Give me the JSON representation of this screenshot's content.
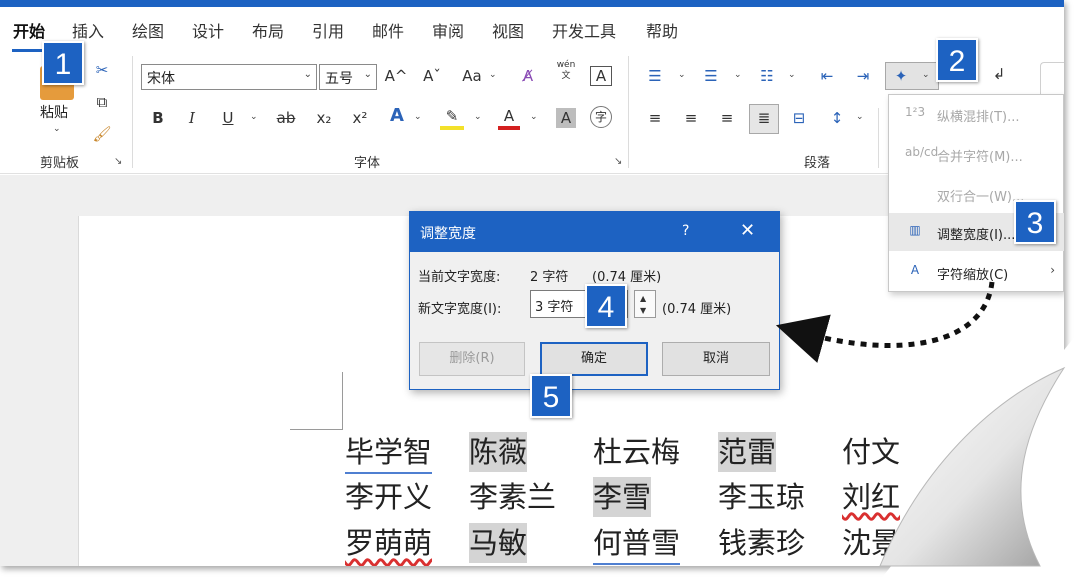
{
  "colors": {
    "accent": "#1d62c2",
    "callout": "#1d62c2",
    "highlight": "#d4d4d4",
    "menu_hover": "#e8e8e8"
  },
  "tabs": [
    "开始",
    "插入",
    "绘图",
    "设计",
    "布局",
    "引用",
    "邮件",
    "审阅",
    "视图",
    "开发工具",
    "帮助"
  ],
  "clipboard": {
    "paste_label": "粘贴",
    "group_label": "剪贴板",
    "icons": [
      "paste-icon",
      "cut-icon",
      "copy-icon",
      "format-painter-icon"
    ]
  },
  "font": {
    "group_label": "字体",
    "font_name": "宋体",
    "font_size": "五号",
    "grow": "A^",
    "shrink": "Aˇ",
    "change_case": "Aa",
    "phonetic_top": "wén",
    "phonetic_bottom": "文",
    "border_char": "A",
    "bold": "B",
    "italic": "I",
    "underline": "U",
    "strike": "ab",
    "subscript": "x₂",
    "superscript": "x²",
    "text_effect": "A",
    "font_color": "A",
    "shading": "A",
    "enclose": "字"
  },
  "paragraph": {
    "group_label": "段落"
  },
  "menu": {
    "items": [
      {
        "icon": "1²3",
        "label": "纵横混排(T)...",
        "disabled": true
      },
      {
        "icon": "ab/cd",
        "label": "合并字符(M)...",
        "disabled": true
      },
      {
        "icon": "",
        "label": "双行合一(W)...",
        "disabled": true
      },
      {
        "icon": "▥",
        "label": "调整宽度(I)...",
        "disabled": false,
        "hover": true
      },
      {
        "icon": "A",
        "label": "字符缩放(C)",
        "disabled": false,
        "submenu": true
      }
    ]
  },
  "dialog": {
    "title": "调整宽度",
    "help": "?",
    "close": "✕",
    "current_label": "当前文字宽度:",
    "current_value": "2 字符",
    "current_cm": "(0.74 厘米)",
    "new_label": "新文字宽度(I):",
    "new_value": "3 字符",
    "new_cm": "(0.74 厘米)",
    "delete_btn": "删除(R)",
    "ok_btn": "确定",
    "cancel_btn": "取消"
  },
  "callouts": [
    "1",
    "2",
    "3",
    "4",
    "5"
  ],
  "document": {
    "names": [
      [
        "毕学智",
        "陈薇",
        "杜云梅",
        "范雷",
        "付文"
      ],
      [
        "李开义",
        "李素兰",
        "李雪",
        "李玉琼",
        "刘红"
      ],
      [
        "罗萌萌",
        "马敏",
        "何普雪",
        "钱素珍",
        "沈景"
      ]
    ]
  }
}
